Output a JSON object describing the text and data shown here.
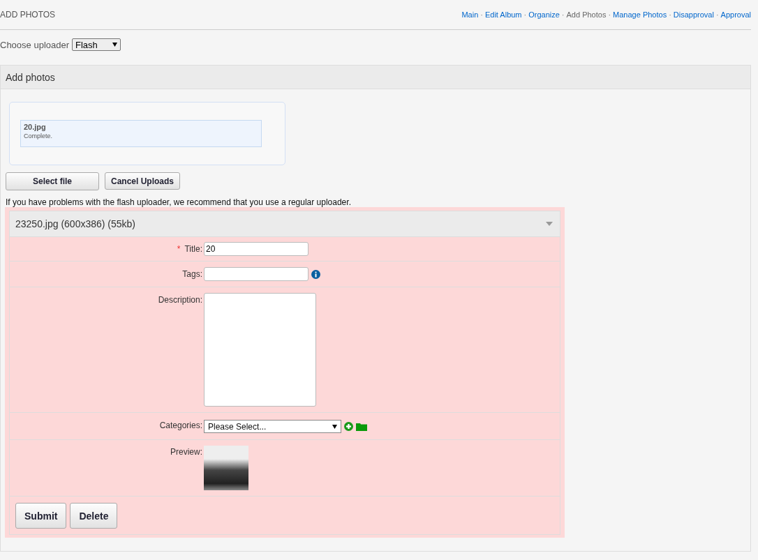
{
  "page_title": "ADD PHOTOS",
  "nav": {
    "separator": "·",
    "links": [
      {
        "label": "Main",
        "selected": false
      },
      {
        "label": "Edit Album",
        "selected": false
      },
      {
        "label": "Organize",
        "selected": false
      },
      {
        "label": "Add Photos",
        "selected": true
      },
      {
        "label": "Manage Photos",
        "selected": false
      },
      {
        "label": "Disapproval",
        "selected": false
      },
      {
        "label": "Approval",
        "selected": false
      }
    ]
  },
  "uploader": {
    "label": "Choose uploader",
    "value": "Flash"
  },
  "panel": {
    "title": "Add photos",
    "queue": [
      {
        "file": "20.jpg",
        "status": "Complete."
      }
    ],
    "buttons": [
      "Select file",
      "Cancel Uploads"
    ],
    "notice": "If you have problems with the flash uploader, we recommend that you use a regular uploader.",
    "item": {
      "header": "23250.jpg (600x386) (55kb)",
      "expanded": true,
      "required_mark": "*",
      "fields": [
        {
          "kind": "text",
          "label": "Title:",
          "required": true,
          "value": "20"
        },
        {
          "kind": "tags",
          "label": "Tags:",
          "required": false
        },
        {
          "kind": "textarea",
          "label": "Description:",
          "required": false
        },
        {
          "kind": "select",
          "label": "Categories:",
          "required": false,
          "value": "Please Select..."
        },
        {
          "kind": "preview",
          "label": "Preview:",
          "required": false
        }
      ],
      "actions": [
        "Submit",
        "Delete"
      ]
    }
  }
}
